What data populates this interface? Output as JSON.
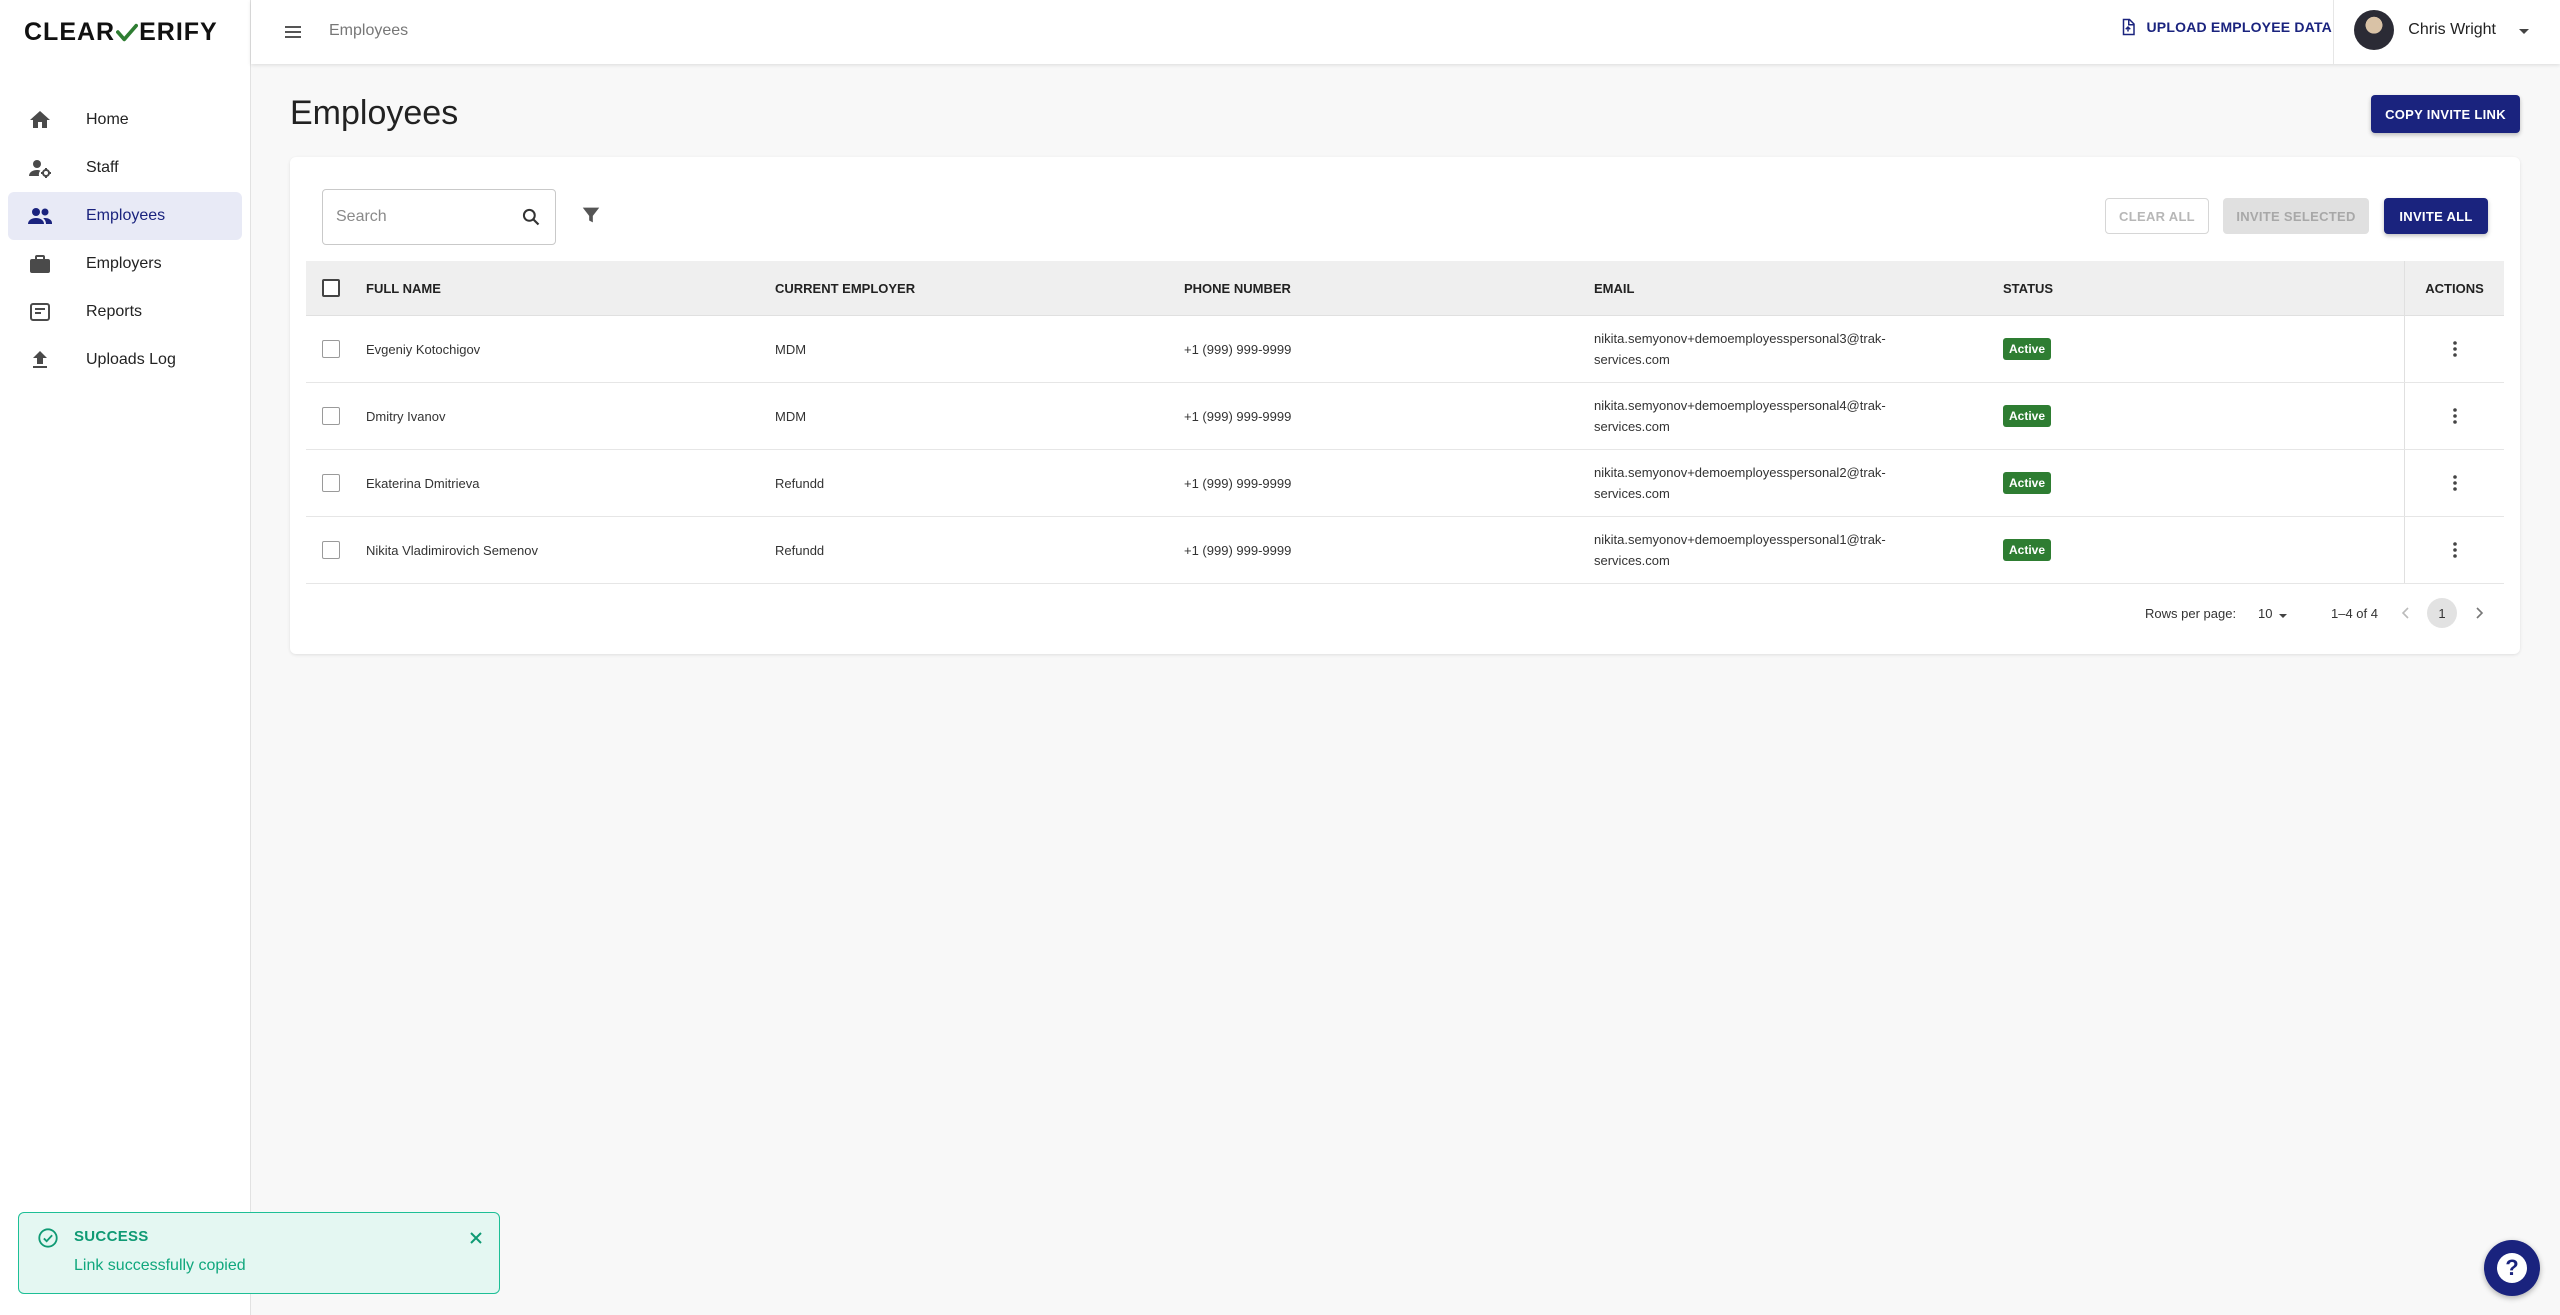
{
  "brand": {
    "logo_left": "CLEAR",
    "logo_right": "ERIFY",
    "logo_icon": "check-v-icon"
  },
  "sidebar": {
    "items": [
      {
        "label": "Home",
        "icon": "home-icon",
        "active": false
      },
      {
        "label": "Staff",
        "icon": "staff-settings-icon",
        "active": false
      },
      {
        "label": "Employees",
        "icon": "people-icon",
        "active": true
      },
      {
        "label": "Employers",
        "icon": "briefcase-icon",
        "active": false
      },
      {
        "label": "Reports",
        "icon": "report-icon",
        "active": false
      },
      {
        "label": "Uploads Log",
        "icon": "upload-icon",
        "active": false
      }
    ]
  },
  "topbar": {
    "breadcrumb": "Employees",
    "upload_label": "UPLOAD EMPLOYEE DATA",
    "user_name": "Chris Wright"
  },
  "main": {
    "title": "Employees",
    "copy_invite_label": "COPY INVITE LINK",
    "search_placeholder": "Search",
    "clear_all_label": "CLEAR ALL",
    "invite_selected_label": "INVITE SELECTED",
    "invite_all_label": "INVITE ALL"
  },
  "table": {
    "columns": [
      "FULL NAME",
      "CURRENT EMPLOYER",
      "PHONE NUMBER",
      "EMAIL",
      "STATUS",
      "ACTIONS"
    ],
    "rows": [
      {
        "name": "Evgeniy Kotochigov",
        "employer": "MDM",
        "phone": "+1 (999) 999-9999",
        "email_line1": "nikita.semyonov+demoemployesspersonal3@trak-",
        "email_line2": "services.com",
        "status": "Active"
      },
      {
        "name": "Dmitry Ivanov",
        "employer": "MDM",
        "phone": "+1 (999) 999-9999",
        "email_line1": "nikita.semyonov+demoemployesspersonal4@trak-",
        "email_line2": "services.com",
        "status": "Active"
      },
      {
        "name": "Ekaterina Dmitrieva",
        "employer": "Refundd",
        "phone": "+1 (999) 999-9999",
        "email_line1": "nikita.semyonov+demoemployesspersonal2@trak-",
        "email_line2": "services.com",
        "status": "Active"
      },
      {
        "name": "Nikita Vladimirovich Semenov",
        "employer": "Refundd",
        "phone": "+1 (999) 999-9999",
        "email_line1": "nikita.semyonov+demoemployesspersonal1@trak-",
        "email_line2": "services.com",
        "status": "Active"
      }
    ]
  },
  "pagination": {
    "rows_per_page_label": "Rows per page:",
    "rows_per_page": "10",
    "range": "1–4 of 4",
    "current_page": "1"
  },
  "toast": {
    "title": "SUCCESS",
    "message": "Link successfully copied"
  },
  "colors": {
    "primary": "#1a237e",
    "active_badge": "#2e7d32",
    "success": "#0f9a74",
    "success_bg": "#e4f7f2"
  }
}
